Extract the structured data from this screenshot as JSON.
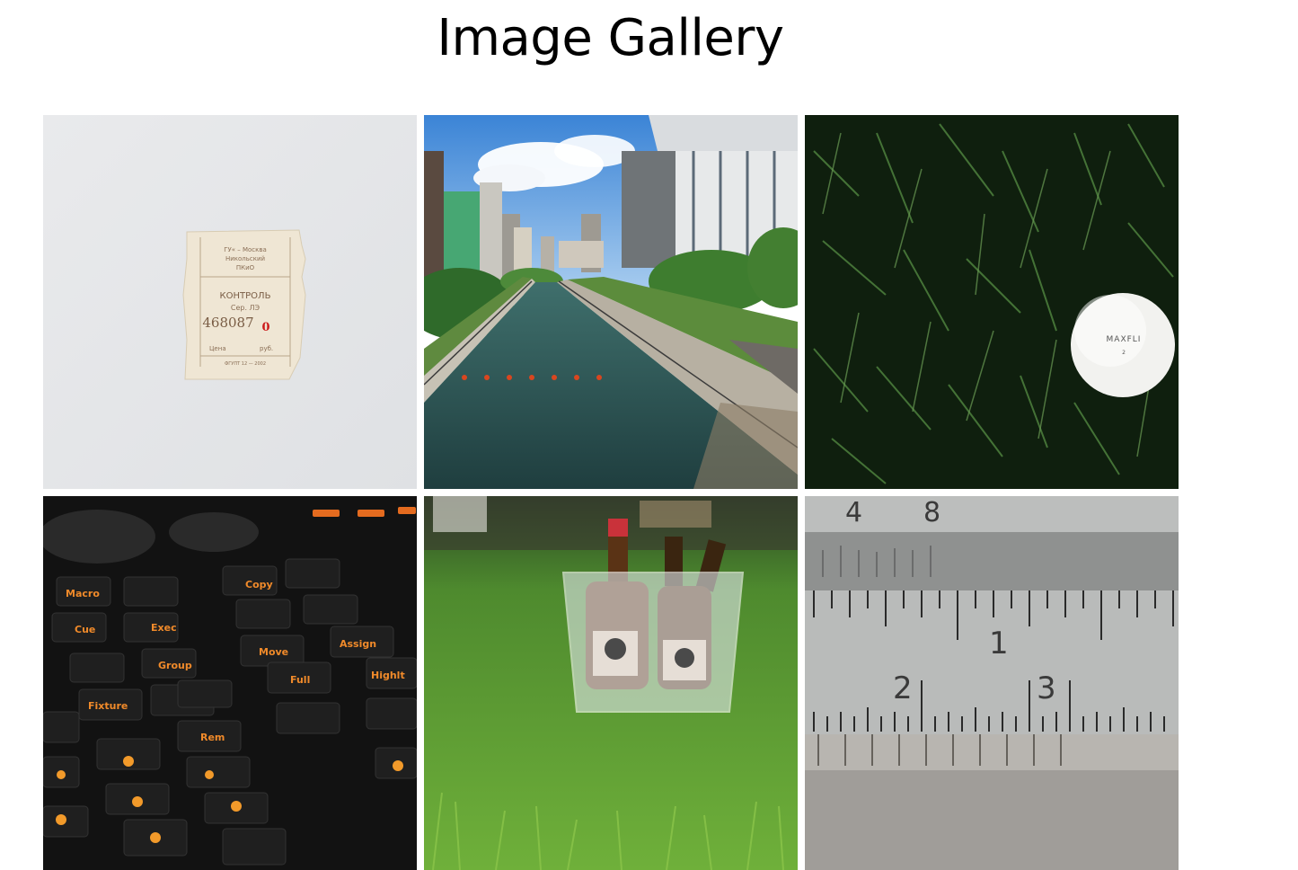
{
  "header": {
    "title": "Image Gallery"
  },
  "gallery": {
    "images": [
      {
        "name": "ticket",
        "ticket": {
          "line1": "ГУ« – Москва",
          "line2": "Никольский",
          "line3": "ПКиО",
          "heading": "КОНТРОЛЬ",
          "series": "Сер. ЛЭ",
          "number": "468087",
          "number_red": "0",
          "price_label": "Цена",
          "currency": "руб.",
          "footer": "ФГУПТ 12 — 2002"
        }
      },
      {
        "name": "canal-city"
      },
      {
        "name": "golf-ball-grass",
        "ball_text": "MAXFLI",
        "ball_number": "2"
      },
      {
        "name": "lighting-console-keyboard",
        "key_labels": [
          "Macro",
          "Cue",
          "Exec",
          "Group",
          "Fixture",
          "Move",
          "Copy",
          "Assign",
          "Full",
          "Highlt",
          "Rem"
        ]
      },
      {
        "name": "beer-bucket-grass"
      },
      {
        "name": "ruler-closeup",
        "numbers": [
          "4",
          "8",
          "1",
          "2",
          "3"
        ]
      }
    ]
  },
  "colors": {
    "background": "#ffffff",
    "title": "#000000"
  }
}
